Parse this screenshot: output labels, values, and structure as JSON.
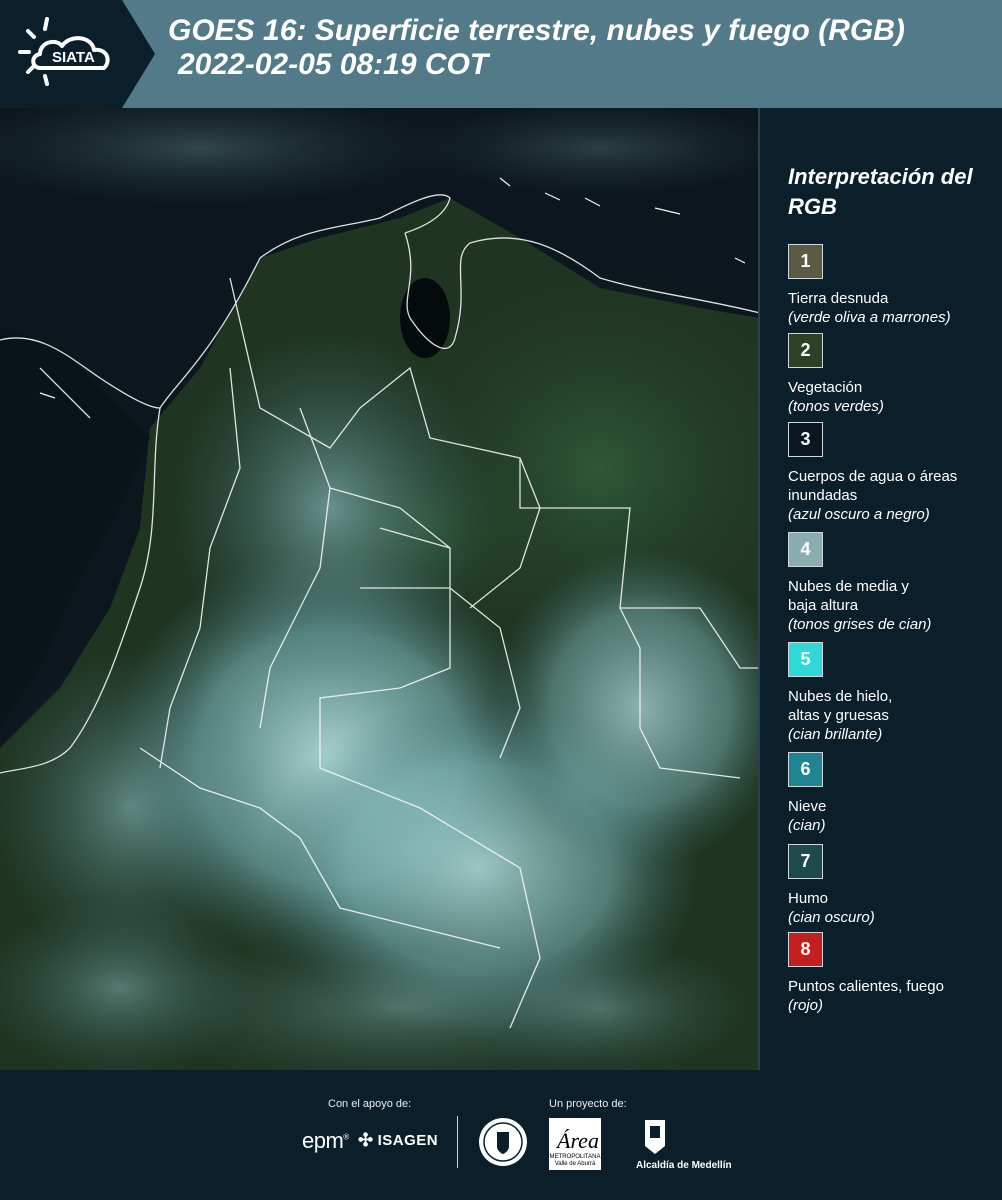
{
  "header": {
    "logo_text": "SIATA",
    "title_line1": "GOES 16: Superficie terrestre, nubes y fuego (RGB)",
    "title_line2": "2022-02-05 08:19 COT"
  },
  "legend": {
    "title": "Interpretación del RGB",
    "items": [
      {
        "number": "1",
        "label": "Tierra desnuda",
        "sub": "(verde oliva a marrones)",
        "color": "#5b5a44"
      },
      {
        "number": "2",
        "label": "Vegetación",
        "sub": "(tonos verdes)",
        "color": "#2d4225"
      },
      {
        "number": "3",
        "label": "Cuerpos de agua o áreas inundadas",
        "sub": "(azul oscuro a negro)",
        "color": "#0b1620"
      },
      {
        "number": "4",
        "label": "Nubes de media y baja altura",
        "sub": "(tonos grises de cian)",
        "color": "#8aaeb0"
      },
      {
        "number": "5",
        "label": "Nubes de hielo, altas y gruesas",
        "sub": "(cian brillante)",
        "color": "#2fd9d9"
      },
      {
        "number": "6",
        "label": "Nieve",
        "sub": "(cian)",
        "color": "#1f8593"
      },
      {
        "number": "7",
        "label": "Humo",
        "sub": "(cian oscuro)",
        "color": "#1d4a4d"
      },
      {
        "number": "8",
        "label": "Puntos calientes, fuego",
        "sub": "(rojo)",
        "color": "#c31f1f"
      }
    ]
  },
  "footer": {
    "support_label": "Con el apoyo de:",
    "project_label": "Un proyecto de:",
    "epm": "epm",
    "isagen": "ISAGEN",
    "area_logo_text": "METROPOLITANA Valle de Aburrá",
    "medellin": "Alcaldía de Medellín"
  }
}
